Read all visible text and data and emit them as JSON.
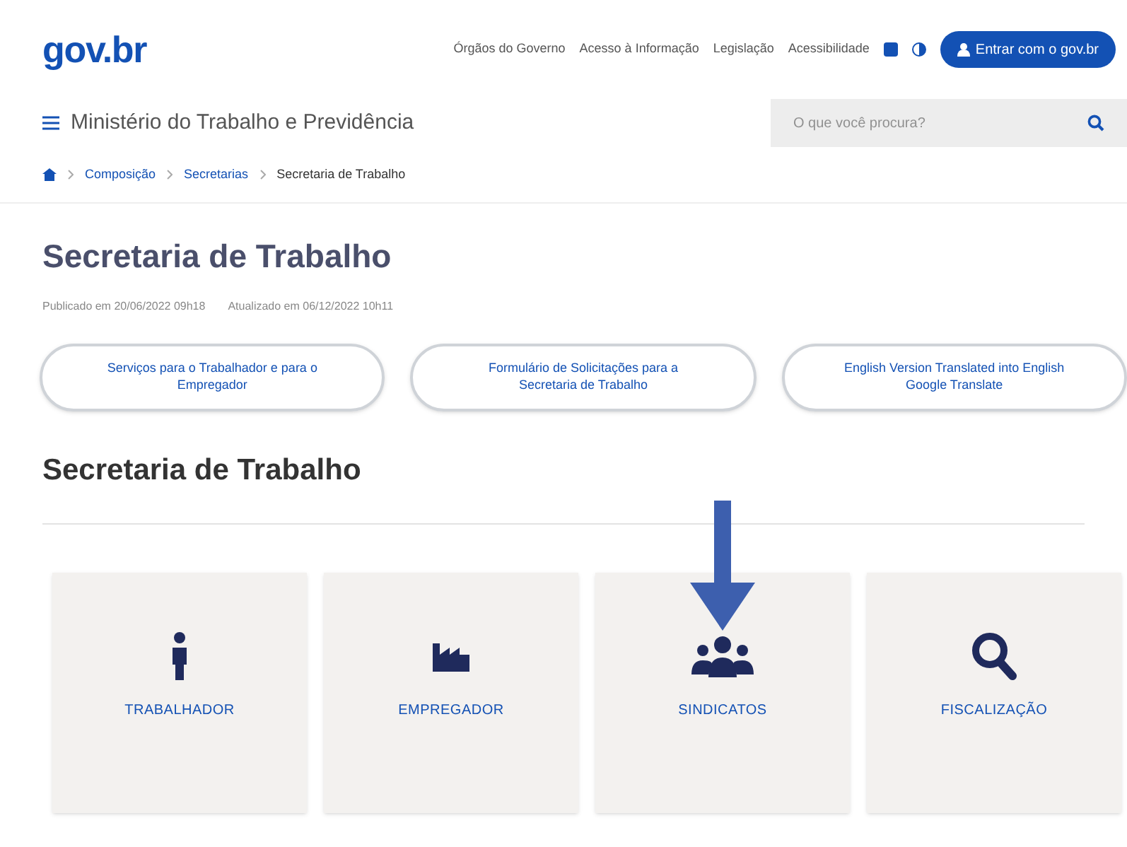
{
  "header": {
    "logo": "gov.br",
    "links": [
      "Órgãos do Governo",
      "Acesso à Informação",
      "Legislação",
      "Acessibilidade"
    ],
    "login_button": "Entrar com o gov.br"
  },
  "menu": {
    "title": "Ministério do Trabalho e Previdência",
    "search": {
      "placeholder": "O que você procura?"
    }
  },
  "breadcrumb": [
    "Composição",
    "Secretarias",
    "Secretaria de Trabalho"
  ],
  "page": {
    "title": "Secretaria de Trabalho",
    "published": "Publicado em 20/06/2022 09h18",
    "updated": "Atualizado em 06/12/2022 10h11"
  },
  "pill_buttons": [
    "Serviços para o Trabalhador e para o Empregador",
    "Formulário de Solicitações para a Secretaria de Trabalho",
    "English Version Translated into English Google Translate"
  ],
  "section_title": "Secretaria de Trabalho",
  "cards": [
    {
      "kind": "worker",
      "label": "TRABALHADOR"
    },
    {
      "kind": "employer",
      "label": "EMPREGADOR"
    },
    {
      "kind": "unions",
      "label": "SINDICATOS"
    },
    {
      "kind": "inspection",
      "label": "FISCALIZAÇÃO"
    }
  ]
}
